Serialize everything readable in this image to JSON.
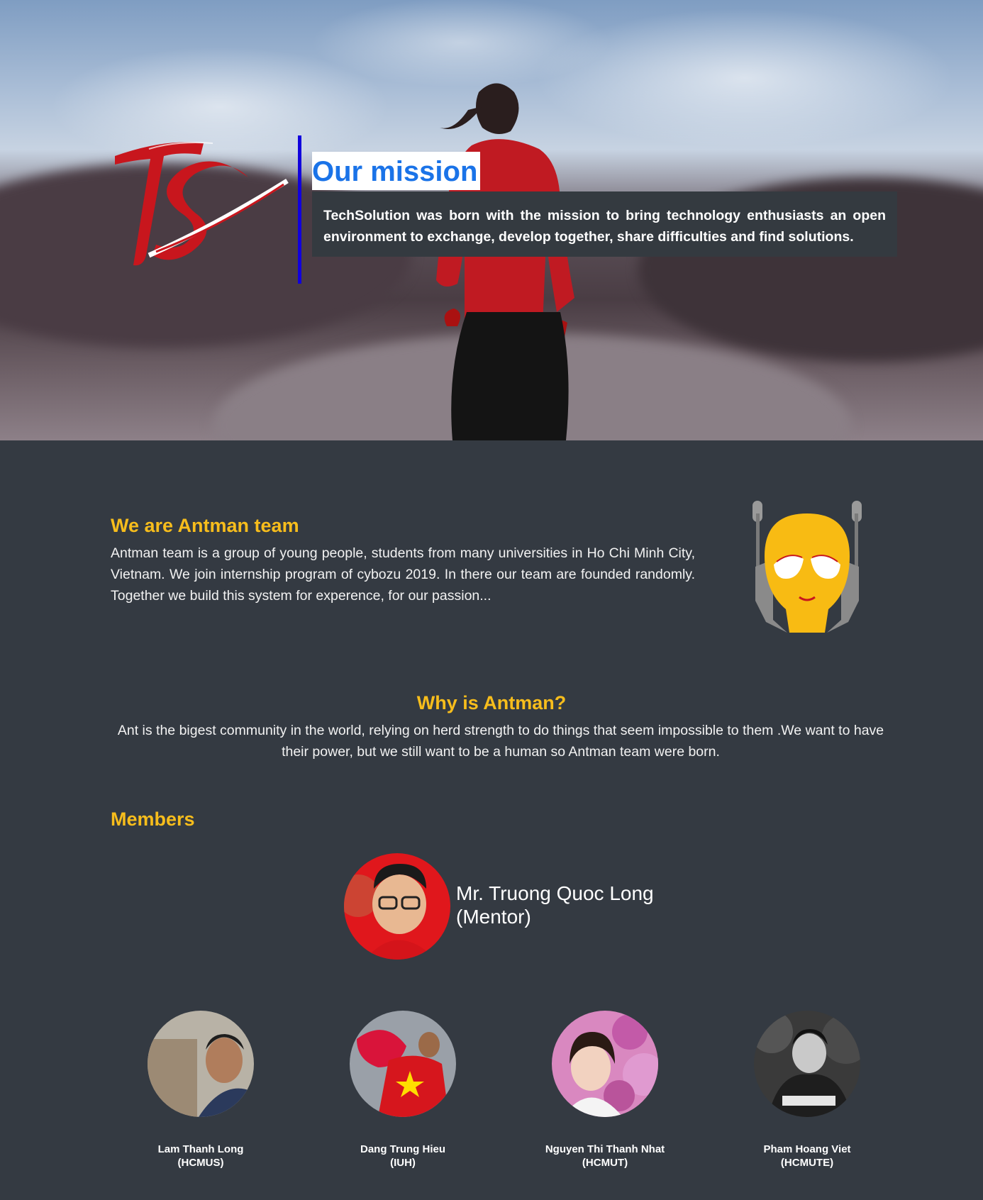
{
  "hero": {
    "logo_text": "TS",
    "mission_title": "Our mission",
    "mission_text": "TechSolution was born with the mission to bring technology enthusiasts an open environment to exchange, develop together, share difficulties and find solutions."
  },
  "about": {
    "title": "We are Antman team",
    "text": "Antman team is a group of young people, students from many universities in Ho Chi Minh City, Vietnam. We join internship program of cybozu 2019. In there our team are founded randomly. Together we build this system for experence, for our passion..."
  },
  "why": {
    "title": "Why is Antman?",
    "text": "Ant is the bigest community in the world, relying on herd strength to do things that seem impossible to them .We want to have their power, but we still want to be a human so Antman team were born."
  },
  "members": {
    "title": "Members",
    "mentor": {
      "name": "Mr. Truong Quoc Long",
      "role": "(Mentor)"
    },
    "list": [
      {
        "name": "Lam Thanh Long",
        "school": "(HCMUS)"
      },
      {
        "name": "Dang Trung Hieu",
        "school": "(IUH)"
      },
      {
        "name": "Nguyen Thi Thanh Nhat",
        "school": "(HCMUT)"
      },
      {
        "name": "Pham Hoang Viet",
        "school": "(HCMUTE)"
      }
    ]
  },
  "colors": {
    "background": "#343a42",
    "accent_yellow": "#f7bd1c",
    "mission_blue": "#1a73e8",
    "divider_blue": "#1100dd",
    "logo_red": "#c8161d"
  }
}
